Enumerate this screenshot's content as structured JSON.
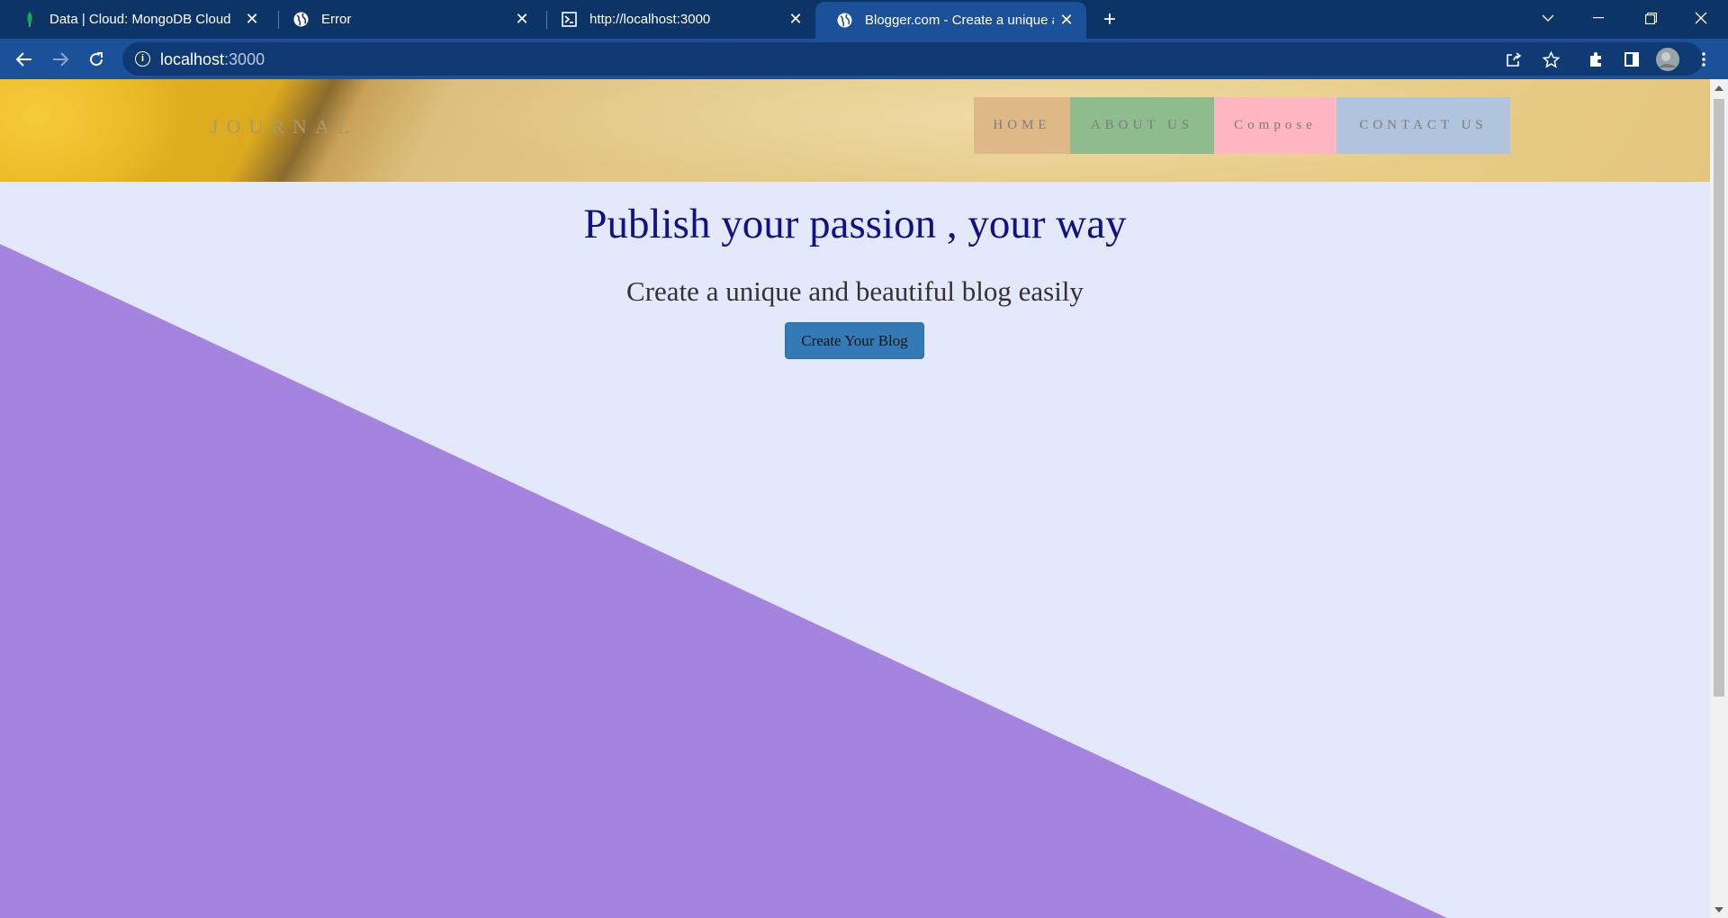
{
  "browser": {
    "tabs": [
      {
        "title": "Data | Cloud: MongoDB Cloud",
        "icon": "mongodb-leaf-icon"
      },
      {
        "title": "Error",
        "icon": "globe-icon"
      },
      {
        "title": "http://localhost:3000",
        "icon": "terminal-icon"
      },
      {
        "title": "Blogger.com - Create a unique ar",
        "icon": "globe-icon",
        "active": true
      }
    ],
    "address": {
      "host": "localhost",
      "port": ":3000"
    }
  },
  "site": {
    "brand": "JOURNAL",
    "nav": [
      {
        "label": "HOME",
        "color": "#deb887"
      },
      {
        "label": "ABOUT US",
        "color": "#8fbc8f"
      },
      {
        "label": "Compose",
        "color": "#ffb6c1"
      },
      {
        "label": "CONTACT US",
        "color": "#b0c4de"
      }
    ]
  },
  "hero": {
    "title": "Publish your passion , your way",
    "subtitle": "Create a unique and beautiful blog easily",
    "cta": "Create Your Blog"
  },
  "colors": {
    "page_bg": "#e3e9fa",
    "triangle": "#a584e0",
    "title_text": "#111186",
    "button": "#337ab7"
  }
}
